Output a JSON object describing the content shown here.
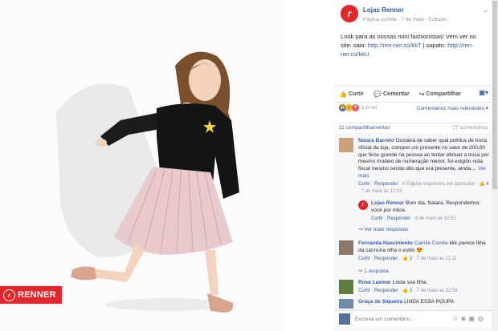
{
  "photo": {
    "brand_badge": "RENNER",
    "logo_letter": "r"
  },
  "post": {
    "page_name": "Lojas Renner",
    "meta": "Página curtida · 7 de maio · Editado ·",
    "caption_text": "Look para as nossas mini fashionistas! Vem ver no site: saia: ",
    "link1": "http://ren-ner.co/kkT",
    "caption_mid": " | sapato: ",
    "link2": "http://ren-ner.co/kkU"
  },
  "actions": {
    "like": "Curtir",
    "comment": "Comentar",
    "share": "Compartilhar"
  },
  "reactions": {
    "count": "1,9 mil",
    "relevance": "Comentários mais relevantes ▾"
  },
  "stats": {
    "shares": "11 compartilhamentos",
    "comments": "27 comentários"
  },
  "comments": [
    {
      "name": "Naiara Barreto",
      "text": " Gostaria de saber qual política de troca oficial da loja, comprei um presente no valor de 200,00 que ficou grande na pessoa ao tentar efetuar a troca por mesmo modelo de numeração menor, foi exigido nota fiscal mesmo sendo dito que era presente, ainda ... ",
      "see_more": "Ver mais",
      "like": "Curtir",
      "reply": "Responder",
      "meta": " · A Página respondeu em particular · ",
      "likes": "👍 4",
      "time": " · 7 de maio às 13:03"
    },
    {
      "name": "Fernanda Nascimento",
      "tag": "Camila Corrêa",
      "text": " kkk parece filha da carinona olha o estilo 😍",
      "like": "Curtir",
      "reply": "Responder",
      "likes": "👍 2",
      "time": " · 7 de maio às 11:11"
    },
    {
      "name": "Rose Lasmar",
      "text": " Linda sua filha.",
      "like": "Curtir",
      "reply": "Responder",
      "likes": "👍 2",
      "time": " · 7 de maio às 12:58"
    },
    {
      "name": "Graça de Siqueira",
      "text": " LINDA ESSA ROUPA"
    }
  ],
  "page_reply": {
    "name": "Lojas Renner",
    "text": " Bom dia, Naiara. Respondemos você por inbox.",
    "like": "Curtir",
    "reply": "Responder",
    "time": " · 8 de maio às 10:51"
  },
  "more_replies": "↪ Ver mais respostas",
  "one_reply": "↪ 1 resposta",
  "composer": {
    "placeholder": "Escreva um comentário..."
  }
}
